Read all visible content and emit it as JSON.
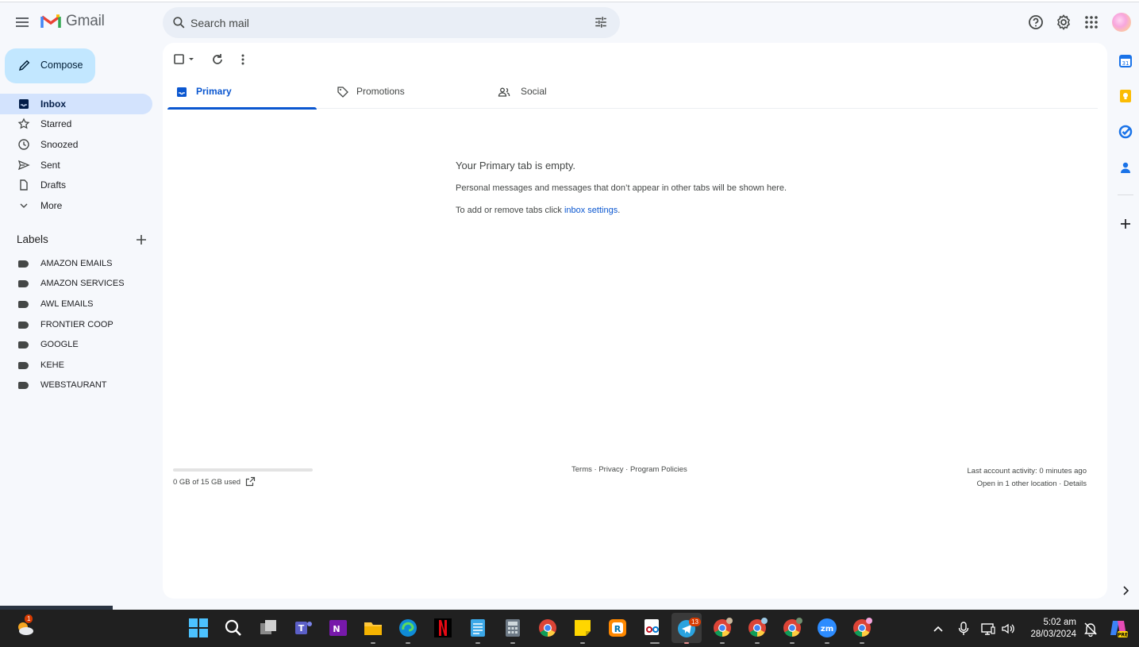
{
  "app": {
    "name": "Gmail"
  },
  "search": {
    "placeholder": "Search mail"
  },
  "compose": {
    "label": "Compose"
  },
  "nav": [
    {
      "label": "Inbox",
      "icon": "inbox-icon",
      "active": true
    },
    {
      "label": "Starred",
      "icon": "star-icon"
    },
    {
      "label": "Snoozed",
      "icon": "clock-icon"
    },
    {
      "label": "Sent",
      "icon": "send-icon"
    },
    {
      "label": "Drafts",
      "icon": "draft-icon"
    },
    {
      "label": "More",
      "icon": "chevron-down-icon"
    }
  ],
  "labels": {
    "heading": "Labels",
    "items": [
      "AMAZON EMAILS",
      "AMAZON SERVICES",
      "AWL EMAILS",
      "FRONTIER COOP",
      "GOOGLE",
      "KEHE",
      "WEBSTAURANT"
    ]
  },
  "tabs": [
    {
      "label": "Primary",
      "icon": "inbox-icon",
      "active": true
    },
    {
      "label": "Promotions",
      "icon": "tag-icon"
    },
    {
      "label": "Social",
      "icon": "people-icon"
    }
  ],
  "empty": {
    "title": "Your Primary tab is empty.",
    "subtitle": "Personal messages and messages that don’t appear in other tabs will be shown here.",
    "add_prefix": "To add or remove tabs click ",
    "add_link": "inbox settings",
    "add_suffix": "."
  },
  "storage": {
    "text": "0 GB of 15 GB used",
    "used_fraction": 0.0
  },
  "footer": {
    "terms": "Terms",
    "privacy": "Privacy",
    "policies": "Program Policies",
    "sep": " · "
  },
  "activity": {
    "line1": "Last account activity: 0 minutes ago",
    "line2_prefix": "Open in 1 other location · ",
    "details": "Details"
  },
  "taskbar": {
    "time": "5:02 am",
    "date": "28/03/2024",
    "weather_badge": "1",
    "telegram_badge": "13"
  },
  "colors": {
    "accent": "#0b57d0",
    "compose_bg": "#c2e7ff",
    "active_nav": "#d3e3fd",
    "background": "#f6f8fc"
  }
}
